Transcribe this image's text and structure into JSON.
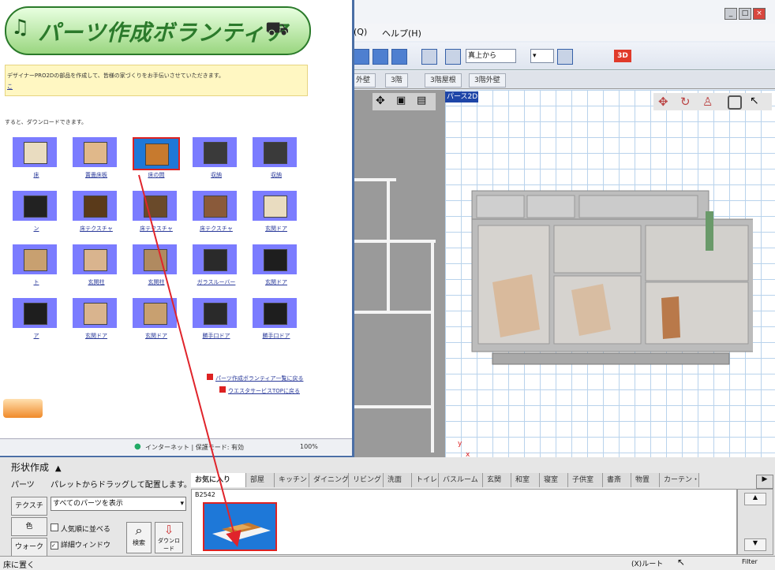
{
  "app": {
    "menu": [
      "(Q)",
      "ヘルプ(H)"
    ],
    "toolbar": {
      "view_select": "真上から",
      "zoom_label": "3D"
    },
    "floor_tabs": [
      "外壁",
      "3階",
      "3階屋根",
      "3階外壁"
    ],
    "view_label": "パース2D",
    "axis_y": "y",
    "axis_x": "x"
  },
  "browser": {
    "banner_title": "パーツ作成ボランティア",
    "notice_text": "デザイナーPRO2Dの部品を作成して、皆様の家づくりをお手伝いさせていただきます。",
    "notice_link": "こ",
    "intro": "すると、ダウンロードできます。",
    "parts": [
      {
        "label": "床"
      },
      {
        "label": "置畳床板"
      },
      {
        "label": "床の間"
      },
      {
        "label": "収納"
      },
      {
        "label": "収納"
      },
      {
        "label": "ン"
      },
      {
        "label": "床テクスチャ"
      },
      {
        "label": "床テクスチャ"
      },
      {
        "label": "床テクスチャ"
      },
      {
        "label": "玄関ドア"
      },
      {
        "label": "ト"
      },
      {
        "label": "玄関柱"
      },
      {
        "label": "玄関柱"
      },
      {
        "label": "ガラスルーバー"
      },
      {
        "label": "玄関ドア"
      },
      {
        "label": "ア"
      },
      {
        "label": "玄関ドア"
      },
      {
        "label": "玄関ドア"
      },
      {
        "label": "勝手口ドア"
      },
      {
        "label": "勝手口ドア"
      }
    ],
    "link1": "パーツ作成ボランティア一覧に戻る",
    "link2": "ウエスタサービスTOPに戻る",
    "status_zone": "インターネット | 保護モード: 有効",
    "zoom": "100%"
  },
  "bottom": {
    "shape_title": "形状作成",
    "left_tabs": [
      "パーツ",
      "テクスチャ",
      "色",
      "ウォーク"
    ],
    "instruction": "パレットからドラッグして配置します。",
    "filter_select": "すべてのパーツを表示",
    "checkbox_popular": "人気順に並べる",
    "checkbox_detail": "詳細ウィンドウ",
    "search_button": "検索",
    "download_button": "ダウンロード",
    "category_tabs": [
      "お気に入り",
      "部屋",
      "キッチン",
      "ダイニング",
      "リビング",
      "洗面",
      "トイレ",
      "バスルーム",
      "玄関",
      "和室",
      "寝室",
      "子供室",
      "書斎",
      "物置",
      "カーテン・ブ"
    ],
    "fav_item_code": "B2542",
    "status_left": "床に置く",
    "status_right": "(X)ルート",
    "status_far": "Filter"
  },
  "colors": {
    "accent_red": "#e0242b",
    "thumb_blue": "#7b7cff",
    "toolbar_blue": "#4e7fd0"
  }
}
